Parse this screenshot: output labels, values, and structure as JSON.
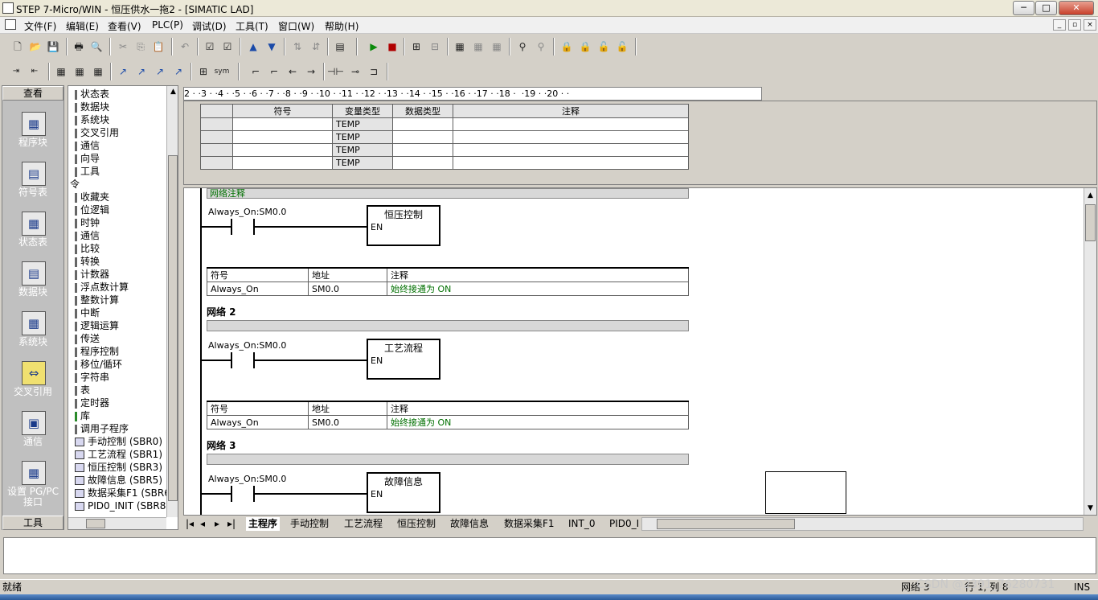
{
  "window": {
    "title": "STEP 7-Micro/WIN - 恒压供水一拖2 - [SIMATIC LAD]",
    "min": "─",
    "max": "□",
    "close": "✕"
  },
  "menu": [
    "文件(F)",
    "编辑(E)",
    "查看(V)",
    "PLC(P)",
    "调试(D)",
    "工具(T)",
    "窗口(W)",
    "帮助(H)"
  ],
  "mdi_buttons": [
    "_",
    "▫",
    "×"
  ],
  "toolbar1_sym": [
    "🗋",
    "📂",
    "💾",
    "🖶",
    "🔍",
    "✂",
    "⎘",
    "📋",
    "↶",
    "☑",
    "☑",
    "▲",
    "▼",
    "⇅",
    "⇵",
    "▤",
    "▶",
    "■",
    "⊞",
    "⊟",
    "▦",
    "▦",
    "▦",
    "⚲",
    "⚲",
    "🔒",
    "🔒",
    "🔓",
    "🔓"
  ],
  "toolbar2_sym": [
    "⇥",
    "⇤",
    "▦",
    "▦",
    "▦",
    "↗",
    "↗",
    "↗",
    "↗",
    "⊞",
    "sym",
    "⌐",
    "⌐",
    "←",
    "→",
    "⊣⊢",
    "⊸",
    "⊐"
  ],
  "nav": {
    "header": "查看",
    "footer": "工具",
    "items": [
      {
        "label": "程序块",
        "icon": "▦"
      },
      {
        "label": "符号表",
        "icon": "▤"
      },
      {
        "label": "状态表",
        "icon": "▦"
      },
      {
        "label": "数据块",
        "icon": "▤"
      },
      {
        "label": "系统块",
        "icon": "▦"
      },
      {
        "label": "交叉引用",
        "icon": "⇔"
      },
      {
        "label": "通信",
        "icon": "▣"
      },
      {
        "label": "设置 PG/PC\n接口",
        "icon": "▦"
      }
    ]
  },
  "tree": [
    "状态表",
    "数据块",
    "系统块",
    "交叉引用",
    "通信",
    "向导",
    "工具",
    "令",
    "收藏夹",
    "位逻辑",
    "时钟",
    "通信",
    "比较",
    "转换",
    "计数器",
    "浮点数计算",
    "整数计算",
    "中断",
    "逻辑运算",
    "传送",
    "程序控制",
    "移位/循环",
    "字符串",
    "表",
    "定时器",
    "库",
    "调用子程序"
  ],
  "subroutines": [
    "手动控制 (SBR0)",
    "工艺流程 (SBR1)",
    "恒压控制 (SBR3)",
    "故障信息 (SBR5)",
    "数据采集F1 (SBR6",
    "PID0_INIT (SBR8)"
  ],
  "ruler": "2 · ·3 · ·4 · ·5 · ·6 · ·7 · ·8 · ·9 · ·10 · ·11 · ·12 · ·13 · ·14 · ·15 · ·16 · ·17 · ·18 ·  ·19 · ·20 · ·",
  "vartable": {
    "headers": [
      "符号",
      "变量类型",
      "数据类型",
      "注释"
    ],
    "rows": [
      "TEMP",
      "TEMP",
      "TEMP",
      "TEMP"
    ]
  },
  "network_comment": "网络注释",
  "networks": [
    {
      "title": "",
      "contact": "Always_On:SM0.0",
      "box": "恒压控制",
      "en": "EN",
      "sym": [
        "Always_On",
        "SM0.0",
        "始终接通为 ON"
      ]
    },
    {
      "title": "网络 2",
      "contact": "Always_On:SM0.0",
      "box": "工艺流程",
      "en": "EN",
      "sym": [
        "Always_On",
        "SM0.0",
        "始终接通为 ON"
      ]
    },
    {
      "title": "网络 3",
      "contact": "Always_On:SM0.0",
      "box": "故障信息",
      "en": "EN"
    }
  ],
  "symhdr": [
    "符号",
    "地址",
    "注释"
  ],
  "tabs": [
    "主程序",
    "手动控制",
    "工艺流程",
    "恒压控制",
    "故障信息",
    "数据采集F1",
    "INT_0",
    "PID0_I"
  ],
  "tabnav": [
    "|◂",
    "◂",
    "▸",
    "▸|"
  ],
  "status": {
    "left": "就绪",
    "mid": "网络 3",
    "pos": "行 1, 列 8",
    "ins": "INS",
    "watermark": "CSDN @2391_76280731"
  }
}
